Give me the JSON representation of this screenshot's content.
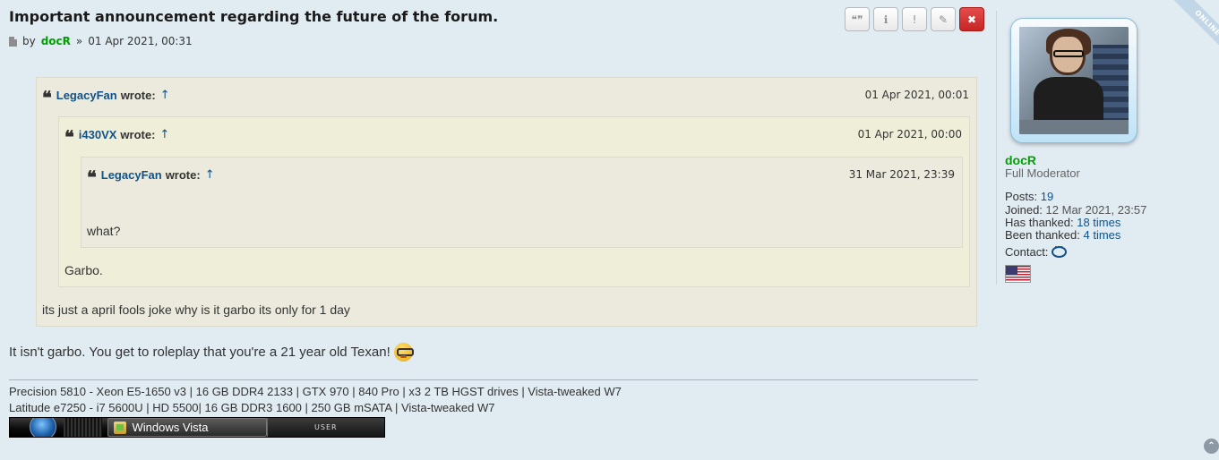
{
  "post": {
    "title": "Important announcement regarding the future of the forum.",
    "meta_by": "by",
    "author": "docR",
    "meta_sep": "»",
    "date": "01 Apr 2021, 00:31",
    "actions": [
      {
        "name": "quote",
        "icon": "quote-icon"
      },
      {
        "name": "info",
        "icon": "info-icon"
      },
      {
        "name": "report",
        "icon": "report-icon"
      },
      {
        "name": "edit",
        "icon": "pencil-icon"
      },
      {
        "name": "delete",
        "icon": "close-icon"
      }
    ]
  },
  "quotes": {
    "outer": {
      "author": "LegacyFan",
      "wrote": "wrote:",
      "arrow": "↑",
      "date": "01 Apr 2021, 00:01",
      "body": "its just a april fools joke why is it garbo its only for 1 day"
    },
    "middle": {
      "author": "i430VX",
      "wrote": "wrote:",
      "arrow": "↑",
      "date": "01 Apr 2021, 00:00",
      "body": "Garbo."
    },
    "inner": {
      "author": "LegacyFan",
      "wrote": "wrote:",
      "arrow": "↑",
      "date": "31 Mar 2021, 23:39",
      "body": "what?"
    }
  },
  "message": "It isn't garbo. You get to roleplay that you're a 21 year old Texan!",
  "signature": {
    "line1": "Precision 5810 - Xeon E5-1650 v3 | 16 GB DDR4 2133 | GTX 970 | 840 Pro | x3 2 TB HGST drives | Vista-tweaked W7",
    "line2": "Latitude e7250 - i7 5600U | HD 5500| 16 GB DDR3 1600 | 250 GB mSATA | Vista-tweaked W7",
    "taskbar_label": "Windows Vista",
    "taskbar_user": "USER"
  },
  "profile": {
    "status": "ONLINE",
    "name": "docR",
    "rank": "Full Moderator",
    "posts_label": "Posts:",
    "posts": "19",
    "joined_label": "Joined:",
    "joined": "12 Mar 2021, 23:57",
    "has_thanked_label": "Has thanked:",
    "has_thanked": "18 times",
    "been_thanked_label": "Been thanked:",
    "been_thanked": "4 times",
    "contact_label": "Contact:"
  },
  "colors": {
    "background": "#e1ebf2",
    "author": "#00a000",
    "link": "#105289",
    "quote_bg": "#ebeadd"
  }
}
